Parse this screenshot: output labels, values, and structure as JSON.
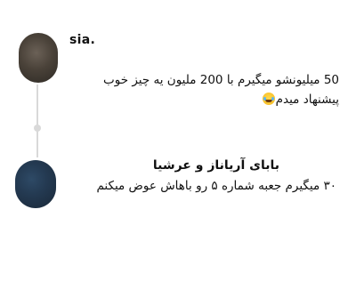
{
  "comments": [
    {
      "username": "sia.",
      "text": "50 میلیونشو میگیرم با 200 ملیون یه چیز خوب پیشنهاد میدم",
      "emoji": "face-with-tears-of-joy"
    },
    {
      "username": "بابای آریاناز و عرشیا",
      "text": "۳۰ میگیرم جعبه شماره ۵ رو باهاش عوض میکنم"
    }
  ],
  "colors": {
    "background": "#ffffff",
    "text": "#111111",
    "thread_line": "#d9d9d9"
  }
}
